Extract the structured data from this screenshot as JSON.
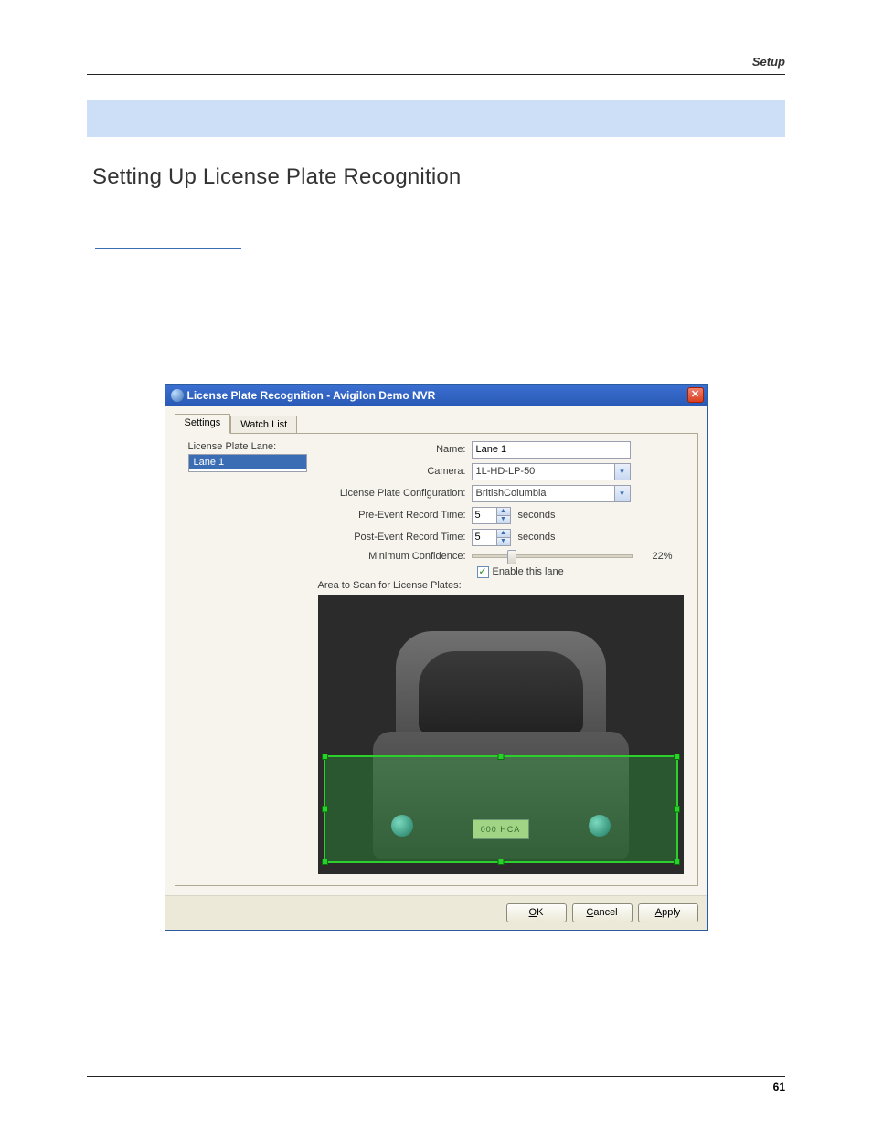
{
  "header": {
    "right": "Setup"
  },
  "sectionTitle": "Setting Up License Plate Recognition",
  "pageNum": "61",
  "dialog": {
    "title": "License Plate Recognition - Avigilon Demo NVR",
    "tabs": {
      "settings": "Settings",
      "watchList": "Watch List"
    },
    "laneList": {
      "label": "License Plate Lane:",
      "items": [
        "Lane 1"
      ]
    },
    "form": {
      "nameLabel": "Name:",
      "nameValue": "Lane 1",
      "cameraLabel": "Camera:",
      "cameraValue": "1L-HD-LP-50",
      "configLabel": "License Plate Configuration:",
      "configValue": "BritishColumbia",
      "preLabel": "Pre-Event Record Time:",
      "preValue": "5",
      "preSuffix": "seconds",
      "postLabel": "Post-Event Record Time:",
      "postValue": "5",
      "postSuffix": "seconds",
      "minConfLabel": "Minimum Confidence:",
      "minConfValue": "22%",
      "minConfPercent": 22,
      "enableLabel": "Enable this lane",
      "enableChecked": true,
      "scanAreaLabel": "Area to Scan for License Plates:"
    },
    "preview": {
      "plateText": "000 HCA"
    },
    "buttons": {
      "ok": "OK",
      "okU": "O",
      "cancel": "Cancel",
      "cancelU": "C",
      "apply": "Apply",
      "applyU": "A"
    }
  }
}
